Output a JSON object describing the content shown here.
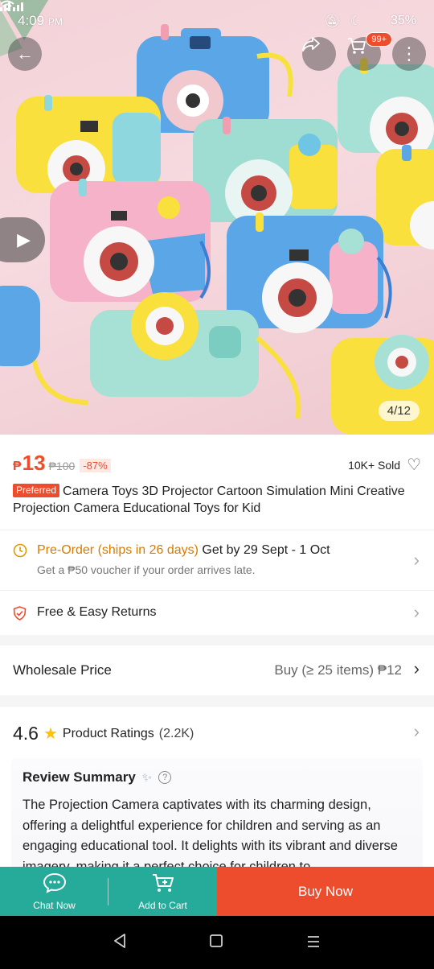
{
  "status_bar": {
    "time": "4:09",
    "ampm": "PM",
    "icons": [
      "mute-icon",
      "moon-icon",
      "wifi-icon",
      "volte-icon",
      "signal-icon",
      "signal-icon"
    ],
    "battery": "35%"
  },
  "gallery": {
    "cart_badge": "99+",
    "page_indicator": "4/12"
  },
  "product": {
    "currency": "₱",
    "price": "13",
    "original_price": "₱100",
    "discount": "-87%",
    "sold": "10K+ Sold",
    "preferred_badge": "Preferred",
    "title": "Camera Toys 3D Projector Cartoon Simulation Mini Creative Projection Camera Educational Toys for Kid"
  },
  "shipping": {
    "preorder_label": "Pre-Order (ships in 26 days)",
    "delivery_text": "Get by 29 Sept - 1 Oct",
    "voucher_note": "Get a ₱50 voucher if your order arrives late."
  },
  "returns": {
    "label": "Free & Easy Returns"
  },
  "wholesale": {
    "label": "Wholesale Price",
    "value": "Buy (≥ 25 items) ₱12"
  },
  "ratings": {
    "score": "4.6",
    "label": "Product Ratings",
    "count": "(2.2K)",
    "summary_title": "Review Summary",
    "summary_text": "The Projection Camera captivates with its charming design, offering a delightful experience for children and serving as an engaging educational tool. It delights with its vibrant and diverse imagery, making it a perfect choice for children to"
  },
  "actions": {
    "chat_label": "Chat Now",
    "add_to_cart_label": "Add to Cart",
    "buy_now_label": "Buy Now"
  },
  "colors": {
    "brand": "#ee4d2d",
    "teal": "#26aa99",
    "preorder": "#d87b00"
  }
}
